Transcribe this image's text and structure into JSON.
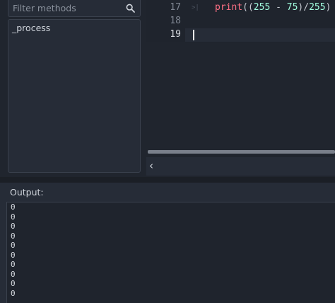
{
  "methods_panel": {
    "filter_placeholder": "Filter methods",
    "filter_value": "",
    "search_icon": "search-icon",
    "items": [
      "_process"
    ]
  },
  "editor": {
    "lines": [
      {
        "number": "17",
        "has_fold_marker": true,
        "code": {
          "fn": "print",
          "open": "((",
          "a": "255",
          "op": " - ",
          "b": "75",
          "mid": ")/",
          "c": "255",
          "close": ")"
        }
      },
      {
        "number": "18",
        "has_fold_marker": false,
        "code": null
      },
      {
        "number": "19",
        "has_fold_marker": false,
        "code": null,
        "current": true
      }
    ],
    "status_chevron": "‹",
    "colors": {
      "function": "#ff7085",
      "number": "#a1ffe0",
      "text": "#c7cbd3"
    }
  },
  "output": {
    "title": "Output:",
    "lines": [
      "0",
      "0",
      "0",
      "0",
      "0",
      "0",
      "0",
      "0",
      "0",
      "0"
    ]
  }
}
